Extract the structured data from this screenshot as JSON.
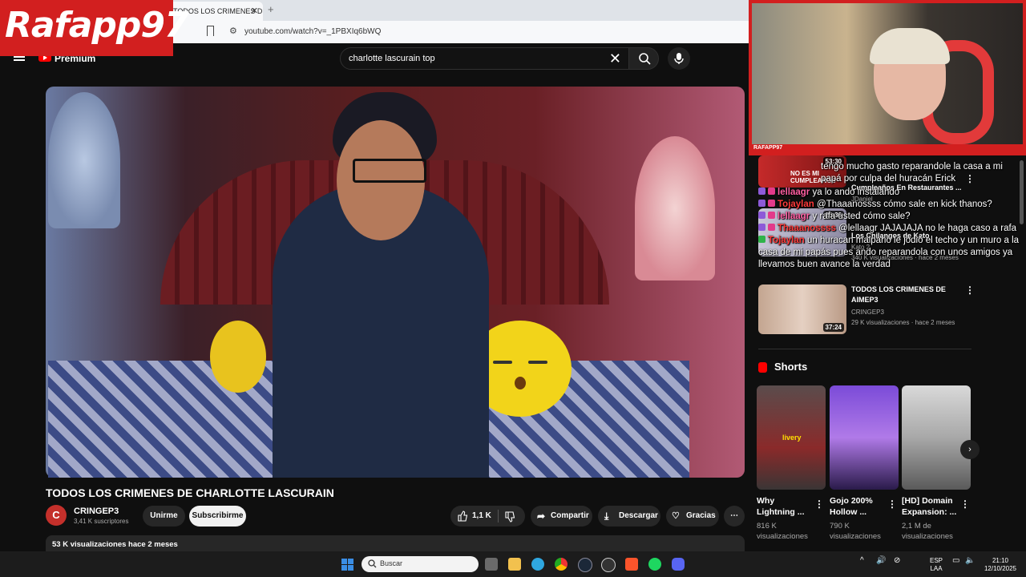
{
  "browser": {
    "tab_title": "TODOS LOS CRIMENES D",
    "tab_close": "✕",
    "new_tab": "+",
    "url": "youtube.com/watch?v=_1PBXIq6bWQ"
  },
  "overlay": {
    "brand": "Rafapp97"
  },
  "youtube": {
    "premium_label": "Premium",
    "search_query": "charlotte lascurain top",
    "search_clear": "✕"
  },
  "video": {
    "title": "TODOS LOS CRIMENES DE CHARLOTTE LASCURAIN",
    "channel_initial": "C",
    "channel": "CRINGEP3",
    "subscribers": "3,41 K suscriptores",
    "join_label": "Unirme",
    "subscribe_label": "Subscribirme",
    "likes": "1,1 K",
    "share_label": "Compartir",
    "download_label": "Descargar",
    "thanks_label": "Gracias",
    "more_label": "⋯",
    "description_stats": "53 K visualizaciones  hace 2 meses"
  },
  "webcam": {
    "label": "RAFAPP97"
  },
  "sidebar": {
    "items": [
      {
        "title": "Cumpleaños En Restaurantes ...",
        "channel": "JDaniel",
        "meta": "",
        "duration": "53:30",
        "thumb_text": "NO ES MI CUMPLEAÑOS"
      },
      {
        "title": "Los Chilangos de Kato",
        "channel": "Kato 2",
        "meta": "340 K visualizaciones · hace 2 meses",
        "duration": "16:36",
        "thumb_text": ""
      },
      {
        "title": "TODOS LOS CRIMENES DE AIMEP3",
        "channel": "CRINGEP3",
        "meta": "29 K visualizaciones · hace 2 meses",
        "duration": "37:24",
        "thumb_text": ""
      }
    ],
    "shorts_heading": "Shorts",
    "shorts": [
      {
        "title": "Why Lightning ...",
        "views": "816 K",
        "views_label": "visualizaciones",
        "thumb_text": "livery"
      },
      {
        "title": "Gojo 200% Hollow ...",
        "views": "790 K",
        "views_label": "visualizaciones",
        "thumb_text": ""
      },
      {
        "title": "[HD] Domain Expansion: ...",
        "views": "2,1 M de",
        "views_label": "visualizaciones",
        "thumb_text": ""
      }
    ]
  },
  "chat": [
    {
      "user": "",
      "text": "tengo mucho gasto reparandole la casa a mi papá por culpa del huracán Erick"
    },
    {
      "user": "lellaagr",
      "text": "ya lo ando instalando"
    },
    {
      "user": "Tojaylan",
      "text": "@Thaaanossss cómo sale en kick thanos?"
    },
    {
      "user": "lellaagr",
      "text": "y rafa usted cómo sale?"
    },
    {
      "user": "Thaaanossss",
      "text": "@lellaagr JAJAJAJA no le haga caso a rafa"
    },
    {
      "user": "Tojaylan",
      "text": "un huracan malparió le jodió el techo y un muro a la casa de mi papás pues ando reparandola con unos amigos ya llevamos buen avance la verdad"
    }
  ],
  "taskbar": {
    "search_placeholder": "Buscar",
    "lang": "ESP",
    "lang2": "LAA",
    "time": "21:10",
    "date": "12/10/2025"
  }
}
